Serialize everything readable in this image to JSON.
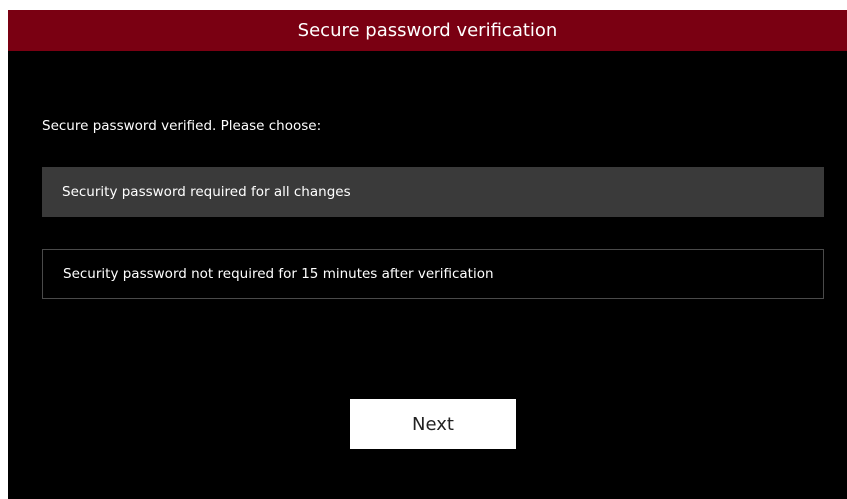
{
  "dialog": {
    "title": "Secure password verification",
    "prompt": "Secure password verified. Please choose:",
    "options": [
      {
        "label": "Security password required for all changes",
        "selected": true
      },
      {
        "label": "Security password not required for 15 minutes after verification",
        "selected": false
      }
    ],
    "next_label": "Next"
  },
  "colors": {
    "title_bar": "#7a0012",
    "background": "#000000",
    "selected_option": "#3a3a3a",
    "button": "#ffffff"
  }
}
